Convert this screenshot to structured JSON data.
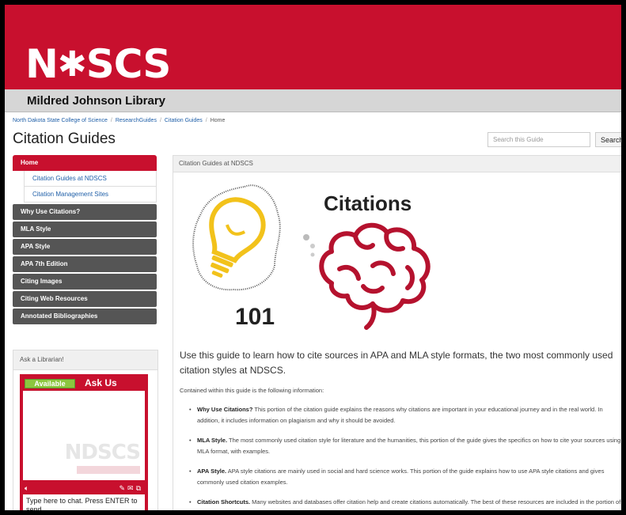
{
  "header": {
    "logo_text": "NDSCS",
    "library_name": "Mildred Johnson Library"
  },
  "breadcrumb": [
    "North Dakota State College of Science",
    "ResearchGuides",
    "Citation Guides",
    "Home"
  ],
  "page_title": "Citation Guides",
  "search": {
    "placeholder": "Search this Guide",
    "button_label": "Search"
  },
  "nav": {
    "home": "Home",
    "sub_items": [
      "Citation Guides at NDSCS",
      "Citation Management Sites"
    ],
    "items": [
      "Why Use Citations?",
      "MLA Style",
      "APA Style",
      "APA 7th Edition",
      "Citing Images",
      "Citing Web Resources",
      "Annotated Bibliographies"
    ]
  },
  "ask": {
    "heading": "Ask a Librarian!",
    "status": "Available",
    "ask_us": "Ask Us",
    "watermark": "NDSCS",
    "input_placeholder": "Type here to chat. Press ENTER to send."
  },
  "main": {
    "box_heading": "Citation Guides at NDSCS",
    "graphic_title": "Citations",
    "graphic_number": "101",
    "intro": "Use this guide to learn how to cite sources in APA and MLA style formats, the two most commonly used citation styles at NDSCS.",
    "contained": "Contained within this guide is the following information:",
    "bullets": [
      {
        "title": "Why Use Citations?",
        "text": " This portion of the citation guide explains the reasons why citations are important in your educational journey and in the real world. In addition, it includes information on plagiarism and why it should be avoided."
      },
      {
        "title": "MLA Style.",
        "text": " The most commonly used citation style for literature and the humanities, this portion of the guide gives the specifics on how to cite your sources using MLA format, with examples."
      },
      {
        "title": "APA Style.",
        "text": " APA style citations are mainly used in social and hard science works. This portion of the guide explains how to use APA style citations and gives commonly used citation examples."
      },
      {
        "title": "Citation Shortcuts.",
        "text": " Many websites and databases offer citation help and create citations automatically. The best of these resources are included in the portion of the guide."
      }
    ]
  },
  "colors": {
    "brand_red": "#c8102e",
    "nav_gray": "#555555",
    "link_blue": "#1f5fa8",
    "available_green": "#8cc63f",
    "bulb_yellow": "#f2c21b"
  }
}
